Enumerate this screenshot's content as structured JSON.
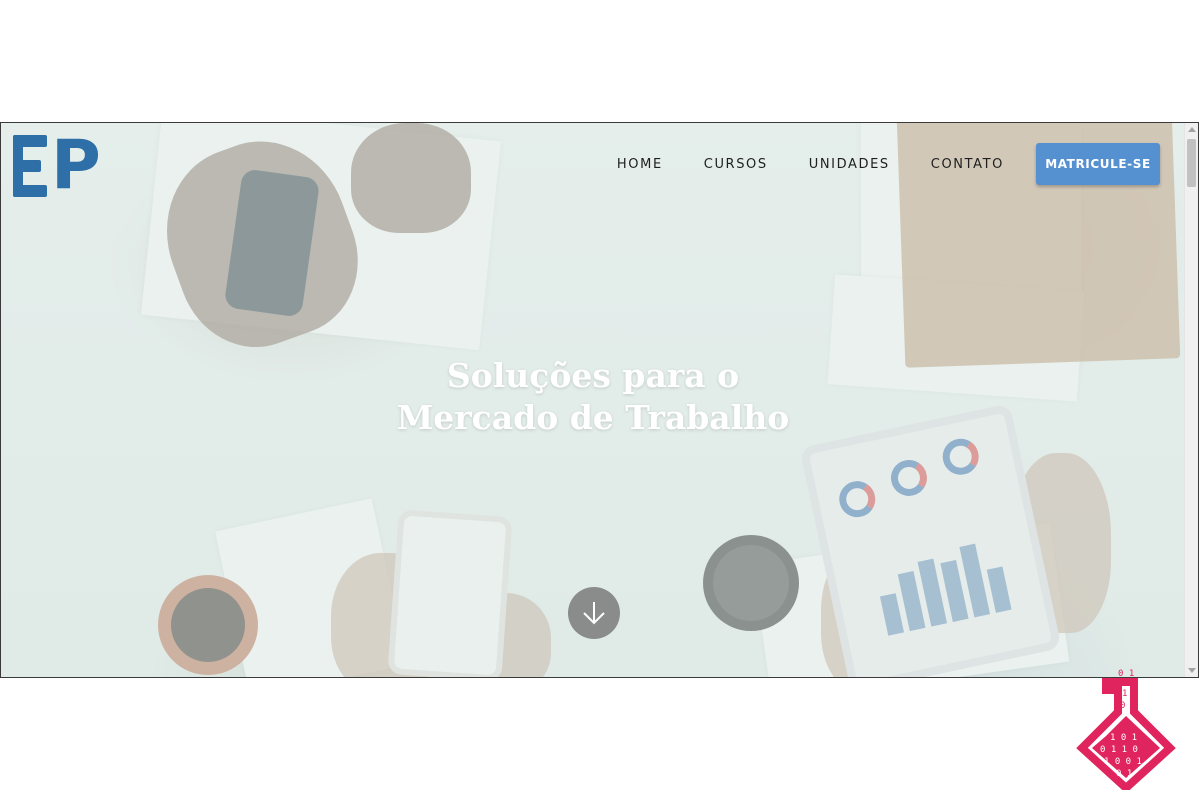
{
  "nav": {
    "items": [
      {
        "label": "HOME"
      },
      {
        "label": "CURSOS"
      },
      {
        "label": "UNIDADES"
      },
      {
        "label": "CONTATO"
      }
    ],
    "cta_label": "MATRICULE-SE"
  },
  "hero": {
    "headline_line1": "Soluções para o",
    "headline_line2": "Mercado de Trabalho"
  },
  "icons": {
    "logo": "ep-logo",
    "scroll": "arrow-down-icon",
    "watermark": "binary-flask-logo"
  },
  "colors": {
    "accent": "#5591d0",
    "logo_blue": "#2f6fa8",
    "watermark": "#e0245e",
    "scroll_button": "#8a8c8b"
  }
}
